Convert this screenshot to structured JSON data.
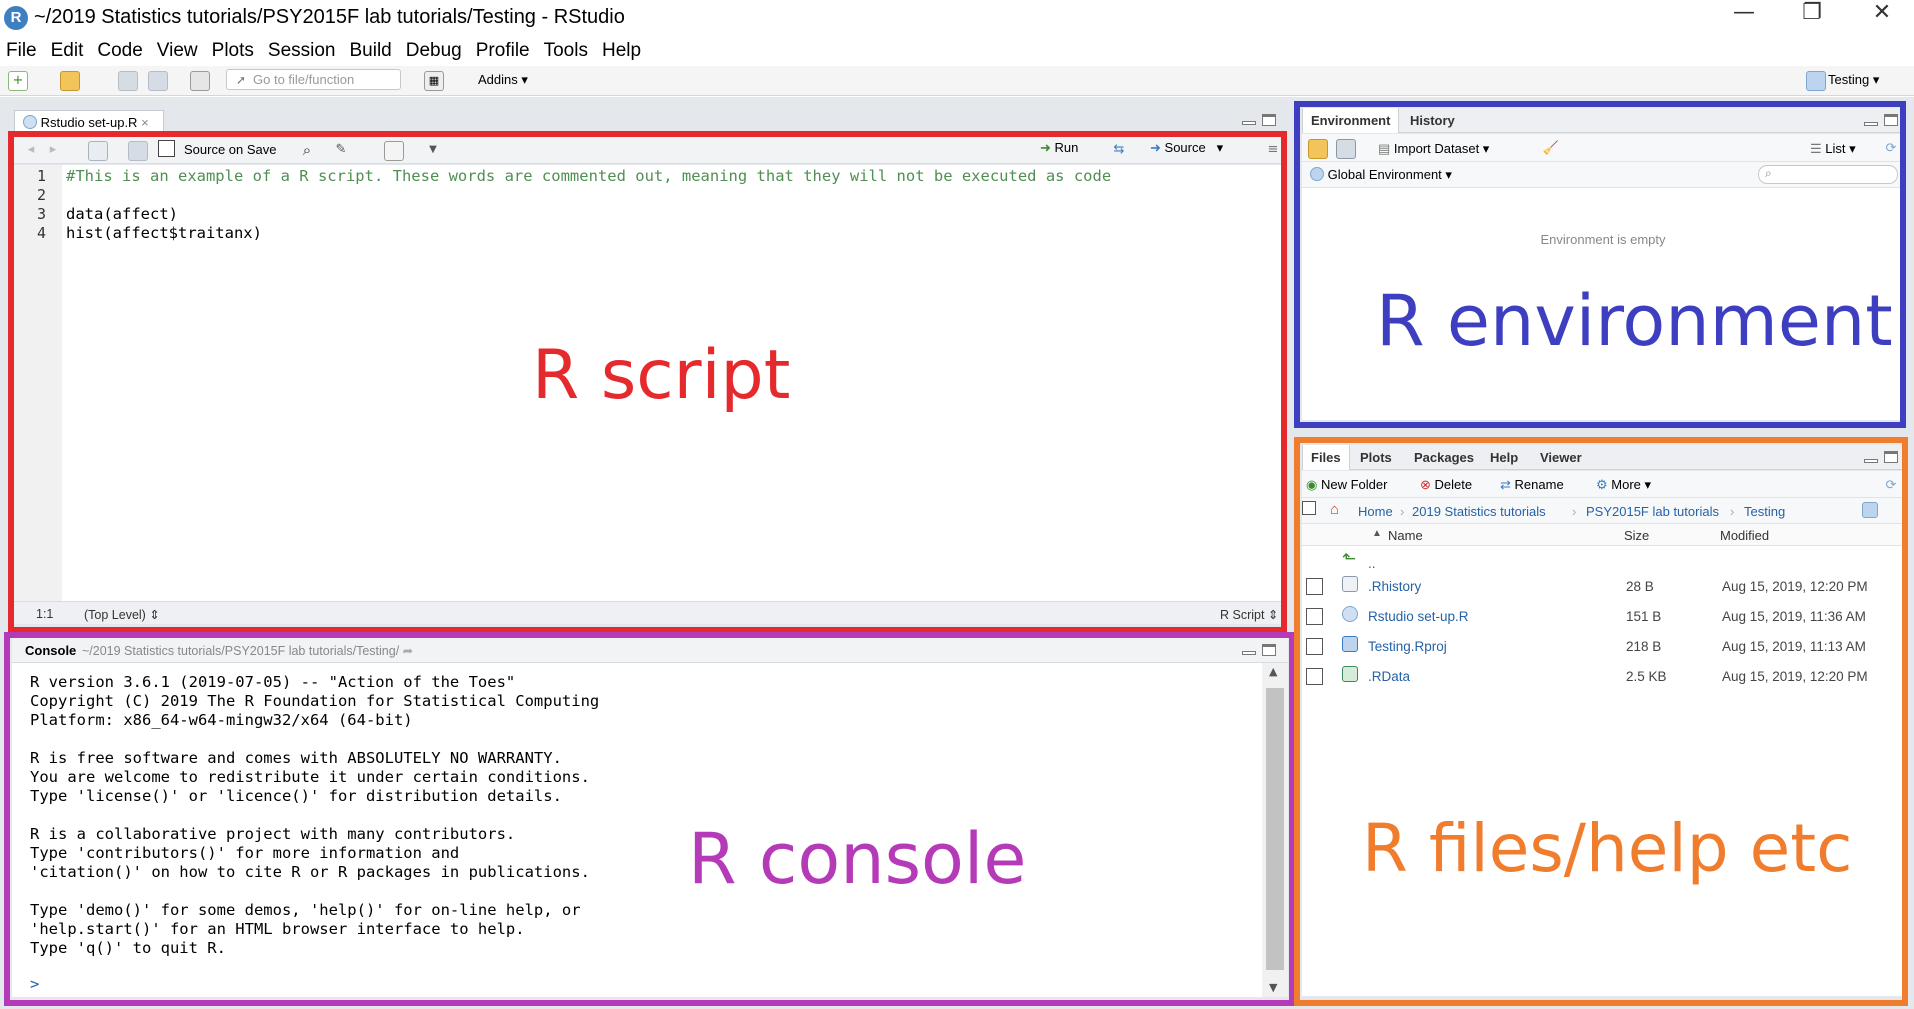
{
  "window": {
    "title": "~/2019 Statistics tutorials/PSY2015F lab tutorials/Testing - RStudio",
    "logo_letter": "R",
    "minimize_glyph": "—",
    "restore_glyph": "❐",
    "close_glyph": "✕"
  },
  "menu": [
    "File",
    "Edit",
    "Code",
    "View",
    "Plots",
    "Session",
    "Build",
    "Debug",
    "Profile",
    "Tools",
    "Help"
  ],
  "toolbar": {
    "goto_placeholder": "Go to file/function",
    "addins_label": "Addins",
    "project_label": "Testing"
  },
  "source": {
    "tab_label": "Rstudio set-up.R",
    "source_on_save_label": "Source on Save",
    "run_label": "Run",
    "source_label": "Source",
    "line_numbers": [
      "1",
      "2",
      "3",
      "4"
    ],
    "code_lines": [
      "#This is an example of a R script. These words are commented out, meaning that they will not be executed as code",
      "",
      "data(affect)",
      "hist(affect$traitanx)"
    ],
    "status_position": "1:1",
    "status_scope": "(Top Level)",
    "status_filetype": "R Script"
  },
  "console": {
    "title": "Console",
    "path": "~/2019 Statistics tutorials/PSY2015F lab tutorials/Testing/",
    "lines": [
      "R version 3.6.1 (2019-07-05) -- \"Action of the Toes\"",
      "Copyright (C) 2019 The R Foundation for Statistical Computing",
      "Platform: x86_64-w64-mingw32/x64 (64-bit)",
      "",
      "R is free software and comes with ABSOLUTELY NO WARRANTY.",
      "You are welcome to redistribute it under certain conditions.",
      "Type 'license()' or 'licence()' for distribution details.",
      "",
      "R is a collaborative project with many contributors.",
      "Type 'contributors()' for more information and",
      "'citation()' on how to cite R or R packages in publications.",
      "",
      "Type 'demo()' for some demos, 'help()' for on-line help, or",
      "'help.start()' for an HTML browser interface to help.",
      "Type 'q()' to quit R."
    ],
    "prompt": ">"
  },
  "environment": {
    "tabs": [
      "Environment",
      "History"
    ],
    "import_label": "Import Dataset",
    "list_label": "List",
    "scope_label": "Global Environment",
    "empty_message": "Environment is empty"
  },
  "files": {
    "tabs": [
      "Files",
      "Plots",
      "Packages",
      "Help",
      "Viewer"
    ],
    "new_folder_label": "New Folder",
    "delete_label": "Delete",
    "rename_label": "Rename",
    "more_label": "More",
    "breadcrumb": [
      "Home",
      "2019 Statistics tutorials",
      "PSY2015F lab tutorials",
      "Testing"
    ],
    "columns": {
      "name": "Name",
      "size": "Size",
      "modified": "Modified"
    },
    "parent_label": "..",
    "rows": [
      {
        "name": ".Rhistory",
        "size": "28 B",
        "modified": "Aug 15, 2019, 12:20 PM",
        "icon": "rhistory-file-icon"
      },
      {
        "name": "Rstudio set-up.R",
        "size": "151 B",
        "modified": "Aug 15, 2019, 11:36 AM",
        "icon": "r-script-file-icon"
      },
      {
        "name": "Testing.Rproj",
        "size": "218 B",
        "modified": "Aug 15, 2019, 11:13 AM",
        "icon": "rproj-file-icon"
      },
      {
        "name": ".RData",
        "size": "2.5 KB",
        "modified": "Aug 15, 2019, 12:20 PM",
        "icon": "rdata-file-icon"
      }
    ]
  },
  "annotations": {
    "script": "R script",
    "console": "R console",
    "environment": "R environment",
    "files": "R files/help etc"
  },
  "colors": {
    "script_box": "#e52a2d",
    "console_box": "#b43ab8",
    "environment_box": "#3e3fc0",
    "files_box": "#f07d2d",
    "link_blue": "#2562a8",
    "comment_green": "#4f8f52"
  }
}
